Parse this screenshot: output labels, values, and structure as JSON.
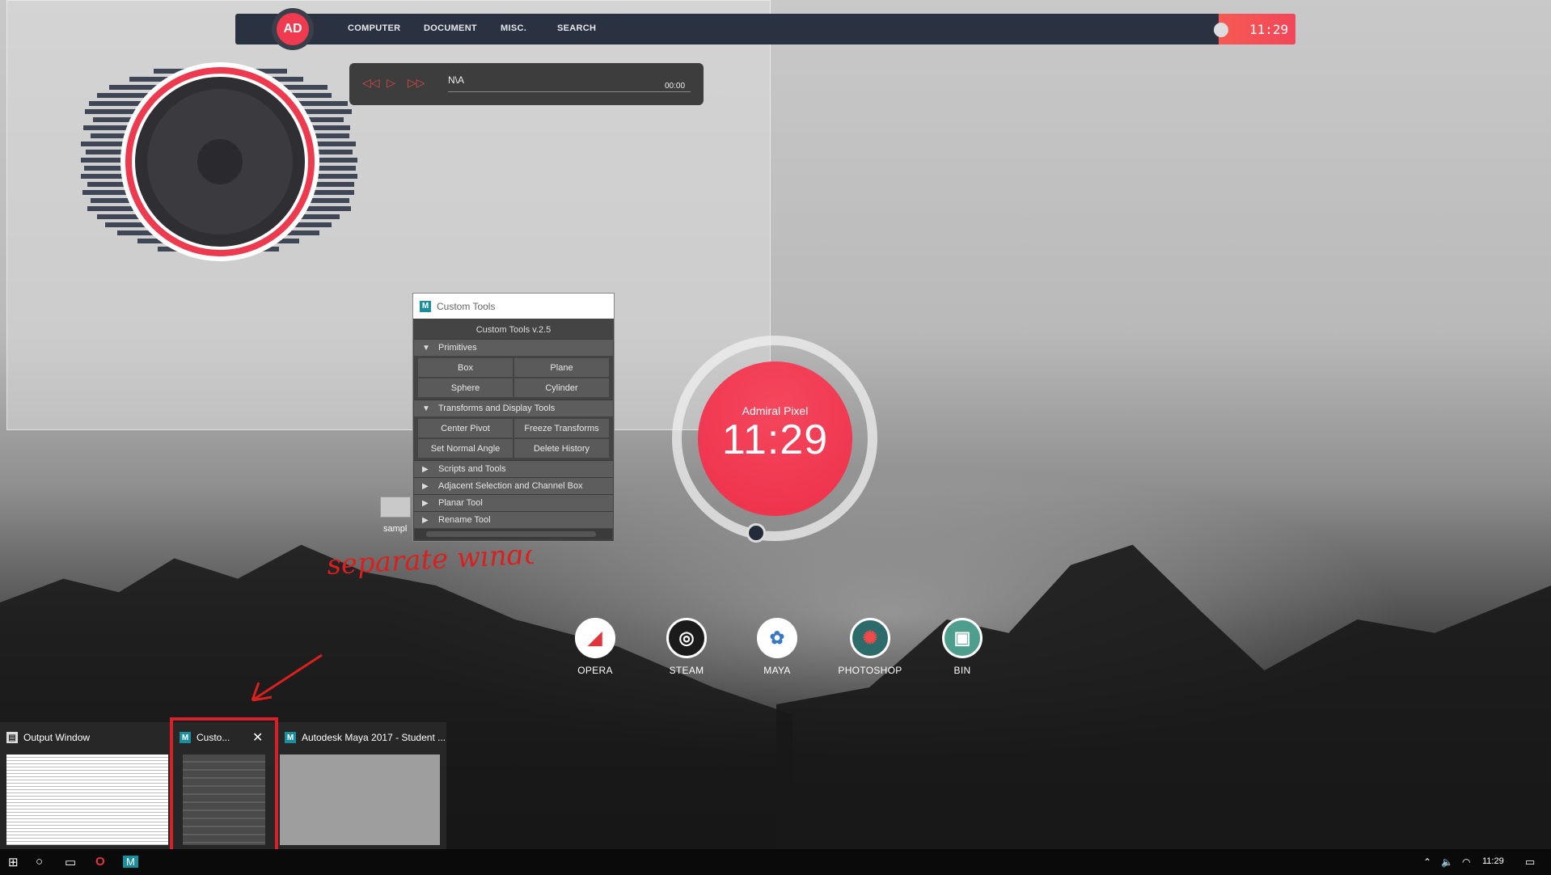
{
  "topbar": {
    "logo_text": "AD",
    "nav": [
      "COMPUTER",
      "DOCUMENT",
      "MISC.",
      "SEARCH"
    ],
    "clock": "11:29"
  },
  "music_player": {
    "prev_icon": "rewind-icon",
    "play_icon": "play-icon",
    "next_icon": "fast-forward-icon",
    "track": "N\\A",
    "time": "00:00"
  },
  "custom_tools": {
    "window_title": "Custom Tools",
    "version_label": "Custom Tools v.2.5",
    "sections": {
      "primitives": {
        "label": "Primitives",
        "buttons": [
          "Box",
          "Plane",
          "Sphere",
          "Cylinder"
        ]
      },
      "transforms": {
        "label": "Transforms and Display Tools",
        "buttons": [
          "Center Pivot",
          "Freeze Transforms",
          "Set Normal Angle",
          "Delete History"
        ]
      },
      "scripts": {
        "label": "Scripts and Tools"
      },
      "adjacent": {
        "label": "Adjacent Selection and Channel Box"
      },
      "planar": {
        "label": "Planar Tool"
      },
      "rename": {
        "label": "Rename Tool"
      }
    }
  },
  "clock_widget": {
    "name": "Admiral Pixel",
    "time": "11:29"
  },
  "desktop_file": {
    "label": "sampl"
  },
  "annotation": {
    "text": "separate window !!",
    "color": "#d9201e"
  },
  "launcher": [
    {
      "label": "OPERA",
      "icon": "opera-icon",
      "color": "#e5333b"
    },
    {
      "label": "STEAM",
      "icon": "steam-icon",
      "color": "#1b1b1b"
    },
    {
      "label": "MAYA",
      "icon": "maya-icon",
      "color": "#3a78c4"
    },
    {
      "label": "PHOTOSHOP",
      "icon": "photoshop-icon",
      "color": "#c63a3a"
    },
    {
      "label": "BIN",
      "icon": "recycle-bin-icon",
      "color": "#4d9e8c"
    }
  ],
  "task_thumbnails": [
    {
      "title": "Output Window"
    },
    {
      "title": "Custo..."
    },
    {
      "title": "Autodesk Maya 2017 - Student ..."
    }
  ],
  "taskbar": {
    "pinned": [
      "start-icon",
      "cortana-icon",
      "task-view-icon",
      "opera-icon",
      "maya-icon"
    ],
    "tray_time": "11:29"
  },
  "colors": {
    "accent": "#ef3a4f",
    "bar": "#2a3140"
  }
}
